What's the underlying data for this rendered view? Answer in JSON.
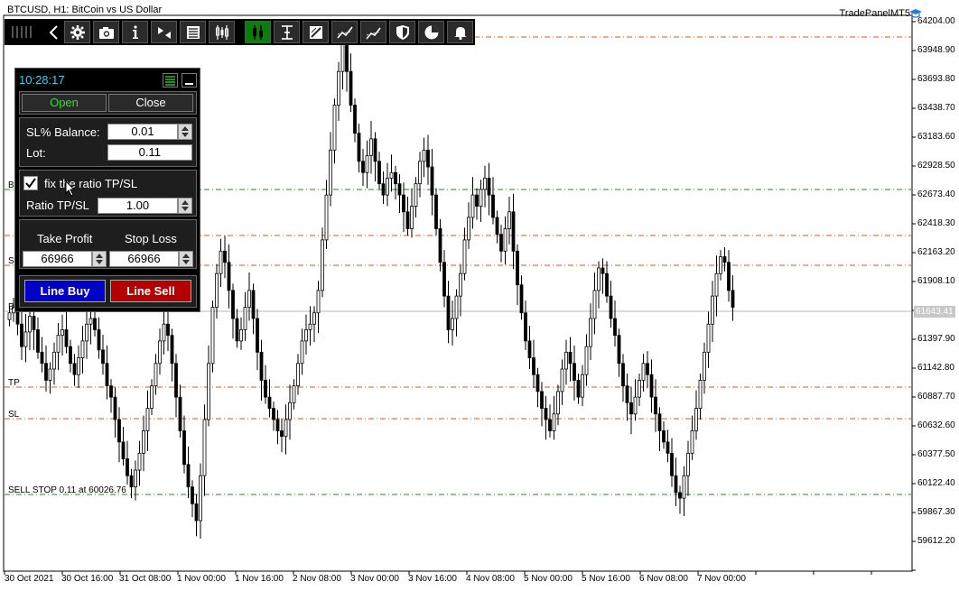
{
  "window": {
    "symbol_title": "BTCUSD, H1:  BitCoin vs US Dollar",
    "brand": "TradePanelMT5"
  },
  "toolbar": {
    "buttons": [
      "grip-icon",
      "back-icon",
      "gear-icon",
      "camera-icon",
      "info-icon",
      "play-icon",
      "list-icon",
      "candles-icon",
      "levels-icon",
      "ruler-icon",
      "draw-icon",
      "trend-icon",
      "trend-arrows-icon",
      "shield-icon",
      "pie-icon",
      "bell-icon"
    ]
  },
  "panel": {
    "clock": "10:28:17",
    "tab_open": "Open",
    "tab_close": "Close",
    "sl_balance_label": "SL% Balance:",
    "sl_balance_value": "0.01",
    "lot_label": "Lot:",
    "lot_value": "0.11",
    "fix_ratio_label": "fix the ratio TP/SL",
    "fix_ratio_checked": true,
    "ratio_label": "Ratio TP/SL",
    "ratio_value": "1.00",
    "tp_label": "Take Profit",
    "sl_label": "Stop Loss",
    "tp_value": "66966",
    "sl_value": "66966",
    "line_buy": "Line Buy",
    "line_sell": "Line Sell"
  },
  "price_axis": [
    "64204.00",
    "63948.90",
    "63693.80",
    "63438.70",
    "63183.60",
    "62928.50",
    "62673.40",
    "62418.30",
    "62163.20",
    "61908.10",
    "61397.90",
    "61142.80",
    "60887.70",
    "60632.60",
    "60377.50",
    "60122.40",
    "59867.30",
    "59612.20"
  ],
  "current_price": "61643.41",
  "time_axis": [
    "30 Oct 2021",
    "30 Oct 16:00",
    "31 Oct 08:00",
    "1 Nov 00:00",
    "1 Nov 16:00",
    "2 Nov 08:00",
    "3 Nov 00:00",
    "3 Nov 16:00",
    "4 Nov 08:00",
    "5 Nov 00:00",
    "5 Nov 16:00",
    "6 Nov 08:00",
    "7 Nov 00:00"
  ],
  "chart_lines": {
    "tp_label": "TP",
    "sl_label": "SL",
    "sell_stop_label": "SELL STOP 0.11 at 60026.76",
    "b_label": "B",
    "s_label": "S",
    "b2_label": "B"
  },
  "colors": {
    "accent_green": "#0d7e0d",
    "buy_blue": "#0000c8",
    "sell_red": "#b40000",
    "clock_cyan": "#37d2ef",
    "open_green": "#26e626",
    "dash_red": "#d45a2a",
    "dash_green": "#2a8a2a"
  },
  "chart_data": {
    "type": "candlestick",
    "series": [
      {
        "values": [
          61750,
          61800,
          61650,
          61450,
          61580,
          61720,
          61600,
          61400,
          61300,
          61150,
          61250,
          61400,
          61550,
          61600,
          61450,
          61300,
          61200,
          61350,
          61500,
          61650,
          61700,
          61600,
          61420,
          61300,
          61100,
          61000,
          60800,
          60600,
          60450,
          60300,
          60200,
          60350,
          60500,
          60700,
          60900,
          61100,
          61300,
          61500,
          61650,
          61550,
          61300,
          61000,
          60700,
          60400,
          60200,
          60050,
          59900,
          60300,
          60800,
          61300,
          61800,
          62100,
          62300,
          62200,
          61950,
          61700,
          61500,
          61600,
          61800,
          61950,
          61700,
          61400,
          61150,
          61000,
          60900,
          60800,
          60700,
          60650,
          60800,
          60950,
          61100,
          61300,
          61500,
          61600,
          61650,
          61750,
          61950,
          62400,
          62800,
          63200,
          63600,
          63900,
          64200,
          63900,
          63600,
          63350,
          63100,
          63000,
          63150,
          63300,
          63100,
          62900,
          62800,
          62950,
          63000,
          62900,
          62800,
          62650,
          62500,
          62700,
          62900,
          63100,
          63200,
          63050,
          62800,
          62500,
          62200,
          61900,
          61600,
          61700,
          61900,
          62100,
          62400,
          62600,
          62800,
          62700,
          62850,
          62950,
          62800,
          62600,
          62450,
          62300,
          62500,
          62650,
          62300,
          62000,
          61750,
          61500,
          61350,
          61200,
          61050,
          60900,
          60800,
          60700,
          60850,
          61050,
          61250,
          61400,
          61300,
          61150,
          61000,
          61200,
          61450,
          61700,
          61950,
          62150,
          62100,
          61900,
          61700,
          61550,
          61300,
          61100,
          60950,
          60850,
          61000,
          61150,
          61300,
          61200,
          61000,
          60850,
          60700,
          60600,
          60500,
          60300,
          60150,
          60100,
          60300,
          60500,
          60700,
          60900,
          61150,
          61400,
          61650,
          61900,
          62100,
          62250,
          62200,
          61950,
          61800
        ]
      }
    ],
    "ylim": [
      59450,
      64400
    ]
  }
}
